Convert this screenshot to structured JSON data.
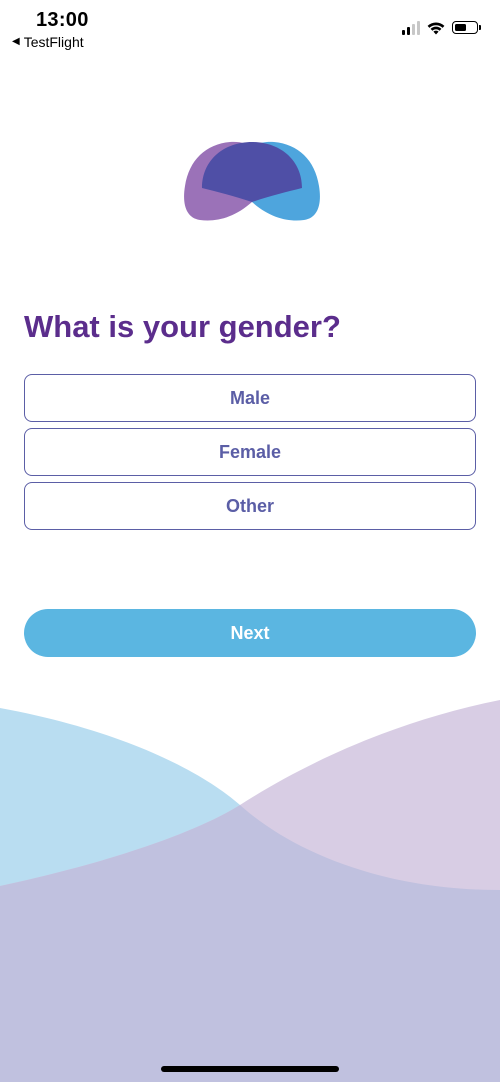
{
  "status_bar": {
    "time": "13:00",
    "back_app": "TestFlight",
    "back_arrow": "◀",
    "signal_icon": "cellular-signal-icon",
    "wifi_icon": "wifi-icon",
    "battery_icon": "battery-icon",
    "battery_level": 0.6
  },
  "logo": {
    "icon": "app-logo",
    "colors": {
      "purple": "#9b72b8",
      "blue": "#4ea5dd",
      "overlap": "#4f4fa6"
    }
  },
  "question": {
    "title": "What is your gender?"
  },
  "options": [
    {
      "label": "Male"
    },
    {
      "label": "Female"
    },
    {
      "label": "Other"
    }
  ],
  "next_button": {
    "label": "Next"
  },
  "colors": {
    "title": "#5b2d8c",
    "option_border": "#5b5ea6",
    "option_text": "#5b5ea6",
    "next_bg": "#5bb6e1",
    "wave_blue": "#b9ddf1",
    "wave_purple": "#d8cde4",
    "wave_overlap": "#c0c1df"
  }
}
